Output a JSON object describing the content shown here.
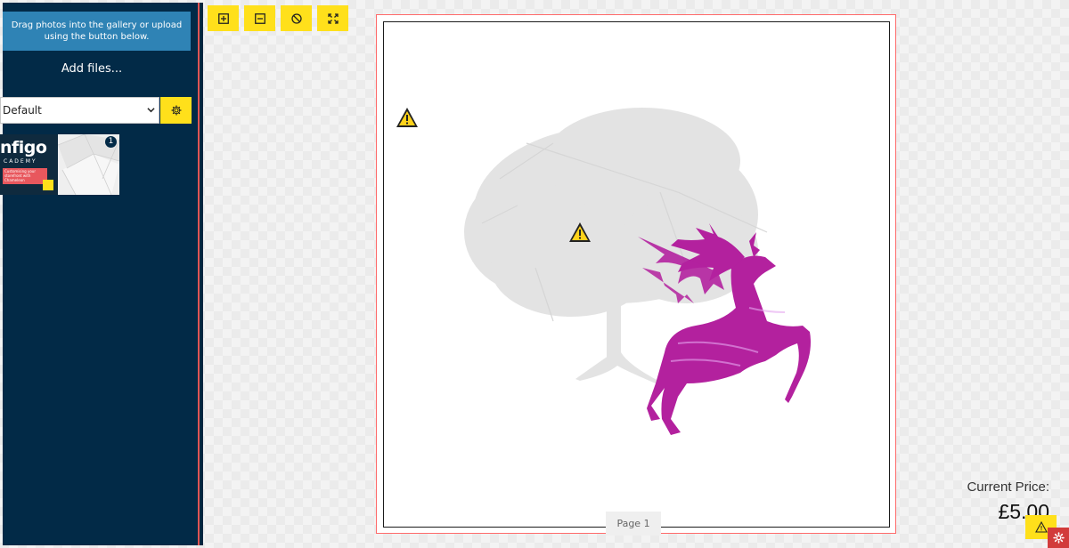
{
  "sidebar": {
    "info_text": "Drag photos into the gallery or upload using the button below.",
    "add_files_label": "Add files...",
    "album_select": {
      "selected": "Default"
    },
    "settings_icon": "gear-icon",
    "thumbnails": [
      {
        "title": "nfigo",
        "subtitle": "CADEMY",
        "banner": "Customising your storefront with Chameleon"
      },
      {
        "badge": "1"
      }
    ]
  },
  "toolbar": {
    "buttons": [
      {
        "icon": "zoom-in-icon"
      },
      {
        "icon": "zoom-out-icon"
      },
      {
        "icon": "clear-icon"
      },
      {
        "icon": "fit-to-page-icon"
      }
    ]
  },
  "canvas": {
    "page_label": "Page 1",
    "warnings": [
      "warning-icon",
      "warning-icon"
    ]
  },
  "price": {
    "label": "Current Price:",
    "value": "£5.00"
  },
  "colors": {
    "sidebar_bg": "#022a47",
    "info_bg": "#2f83b5",
    "accent": "#ffe01b",
    "bleed_line": "#ff6a6a",
    "deer": "#b3219e"
  }
}
